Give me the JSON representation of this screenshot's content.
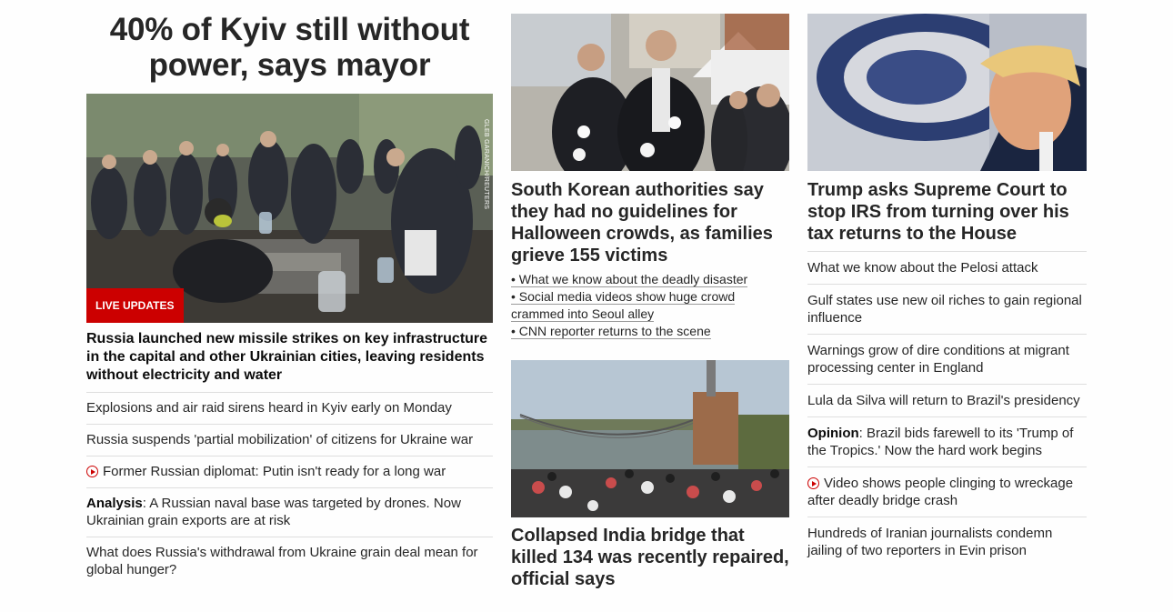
{
  "col1": {
    "headline": "40% of Kyiv still without power, says mayor",
    "photo_credit": "GLEB GARANICH/REUTERS",
    "badge": "LIVE UPDATES",
    "summary": "Russia launched new missile strikes on key infrastructure in the capital and other Ukrainian cities, leaving residents without electricity and water",
    "links": [
      {
        "text": "Explosions and air raid sirens heard in Kyiv early on Monday"
      },
      {
        "text": "Russia suspends 'partial mobilization' of citizens for Ukraine war"
      },
      {
        "icon": "play-icon",
        "text": "Former Russian diplomat: Putin isn't ready for a long war"
      },
      {
        "prefix": "Analysis",
        "text": ": A Russian naval base was targeted by drones. Now Ukrainian grain exports are at risk"
      },
      {
        "text": "What does Russia's withdrawal from Ukraine grain deal mean for global hunger?"
      }
    ]
  },
  "col2": {
    "story1": {
      "headline": "South Korean authorities say they had no guidelines for Halloween crowds, as families grieve 155 victims",
      "bullets": [
        "• What we know about the deadly disaster",
        "• Social media videos show huge crowd crammed into Seoul alley",
        "• CNN reporter returns to the scene"
      ]
    },
    "story2": {
      "headline": "Collapsed India bridge that killed 134 was recently repaired, official says"
    }
  },
  "col3": {
    "headline": "Trump asks Supreme Court to stop IRS from turning over his tax returns to the House",
    "links": [
      {
        "text": "What we know about the Pelosi attack"
      },
      {
        "text": "Gulf states use new oil riches to gain regional influence"
      },
      {
        "text": "Warnings grow of dire conditions at migrant processing center in England"
      },
      {
        "text": "Lula da Silva will return to Brazil's presidency"
      },
      {
        "prefix": "Opinion",
        "text": ": Brazil bids farewell to its 'Trump of the Tropics.' Now the hard work begins"
      },
      {
        "icon": "play-icon",
        "text": "Video shows people clinging to wreckage after deadly bridge crash"
      },
      {
        "text": "Hundreds of Iranian journalists condemn jailing of two reporters in Evin prison"
      }
    ]
  },
  "colors": {
    "accent": "#cc0000",
    "text": "#262626",
    "divider": "#dedede"
  }
}
